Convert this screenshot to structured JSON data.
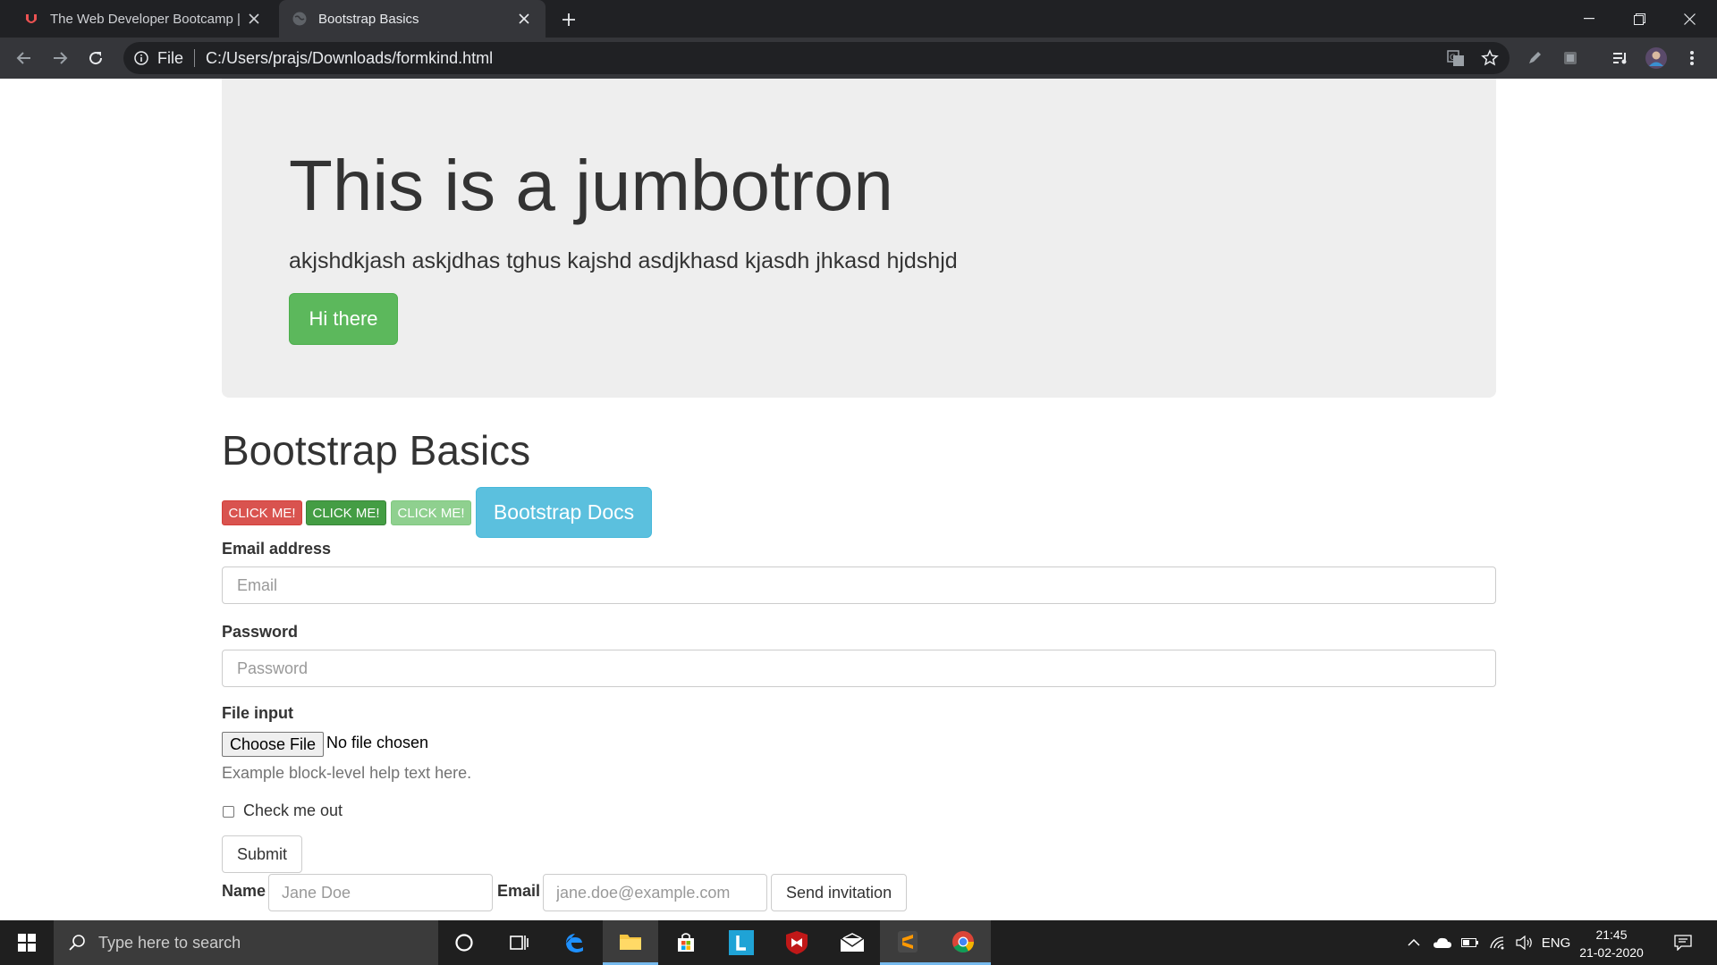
{
  "browser": {
    "tabs": [
      {
        "title": "The Web Developer Bootcamp | U",
        "favicon": "udemy-icon",
        "active": false
      },
      {
        "title": "Bootstrap Basics",
        "favicon": "globe-icon",
        "active": true
      }
    ],
    "address": {
      "scheme_label": "File",
      "url": "C:/Users/prajs/Downloads/formkind.html"
    }
  },
  "jumbotron": {
    "title": "This is a jumbotron",
    "text": "akjshdkjash askjdhas tghus kajshd asdjkhasd kjasdh jhkasd hjdshjd",
    "button": "Hi there"
  },
  "page": {
    "heading": "Bootstrap Basics",
    "buttons": {
      "danger": "CLICK ME!",
      "success": "CLICK ME!",
      "success_disabled": "CLICK ME!",
      "docs": "Bootstrap Docs"
    }
  },
  "form": {
    "email_label": "Email address",
    "email_placeholder": "Email",
    "password_label": "Password",
    "password_placeholder": "Password",
    "file_label": "File input",
    "file_button": "Choose File",
    "file_status": "No file chosen",
    "help_text": "Example block-level help text here.",
    "checkbox_label": "Check me out",
    "submit": "Submit"
  },
  "inline_form": {
    "name_label": "Name",
    "name_placeholder": "Jane Doe",
    "email_label": "Email",
    "email_placeholder": "jane.doe@example.com",
    "button": "Send invitation"
  },
  "taskbar": {
    "search_placeholder": "Type here to search",
    "language": "ENG",
    "time": "21:45",
    "date": "21-02-2020"
  },
  "colors": {
    "jumbotron_bg": "#eeeeee",
    "success": "#5cb85c",
    "danger": "#d9534f",
    "info": "#5bc0de"
  }
}
